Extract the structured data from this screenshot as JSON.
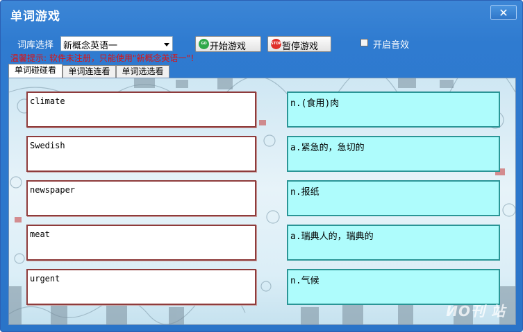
{
  "window": {
    "title": "单词游戏",
    "close_label": "✕"
  },
  "toolbar": {
    "library_label": "词库选择",
    "library_selected": "新概念英语一",
    "start_label": "开始游戏",
    "start_icon_text": "GO",
    "pause_label": "暂停游戏",
    "pause_icon_text": "STOP",
    "sound_label": "开启音效",
    "sound_checked": false
  },
  "warning": "温馨提示: 软件未注册，只能使用\"新概念英语一\"！",
  "tabs": [
    {
      "label": "单词碰碰看",
      "active": true
    },
    {
      "label": "单词连连看",
      "active": false
    },
    {
      "label": "单词选选看",
      "active": false
    }
  ],
  "words": [
    "climate",
    "Swedish",
    "newspaper",
    "meat",
    "urgent"
  ],
  "definitions": [
    "n.(食用)肉",
    "a.紧急的，急切的",
    "n.报纸",
    "a.瑞典人的，瑞典的",
    "n.气候"
  ],
  "watermark": "ИО刊 站",
  "colors": {
    "title_bar": "#2f7bd0",
    "word_border": "#8e3b3b",
    "def_bg": "#aefcfc",
    "def_border": "#2a9596",
    "warning": "#e01010"
  }
}
